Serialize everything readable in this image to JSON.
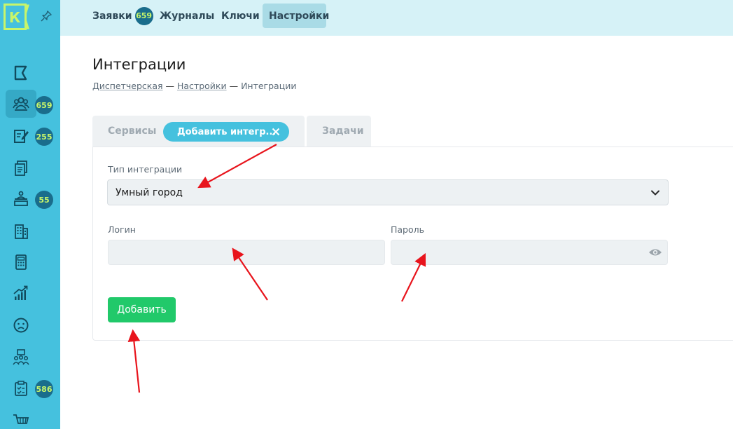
{
  "nav": {
    "items": [
      {
        "label": "Заявки",
        "badge": "659"
      },
      {
        "label": "Журналы"
      },
      {
        "label": "Ключи"
      },
      {
        "label": "Настройки"
      }
    ]
  },
  "sidebar": {
    "logo_letter": "К",
    "badges": [
      "659",
      "255",
      "55",
      "586"
    ]
  },
  "page": {
    "title": "Интеграции",
    "breadcrumb": [
      "Диспетчерская",
      "Настройки",
      "Интеграции"
    ]
  },
  "tabs": {
    "services": "Сервисы",
    "add": "Добавить интегр...",
    "tasks": "Задачи"
  },
  "form": {
    "type_label": "Тип интеграции",
    "type_value": "Умный город",
    "login_label": "Логин",
    "password_label": "Пароль",
    "login_value": "",
    "password_value": "",
    "submit_label": "Добавить"
  },
  "colors": {
    "accent": "#45c1de",
    "success": "#21c96a",
    "badge": "#1a6d8c",
    "annotation": "#e8141c"
  }
}
